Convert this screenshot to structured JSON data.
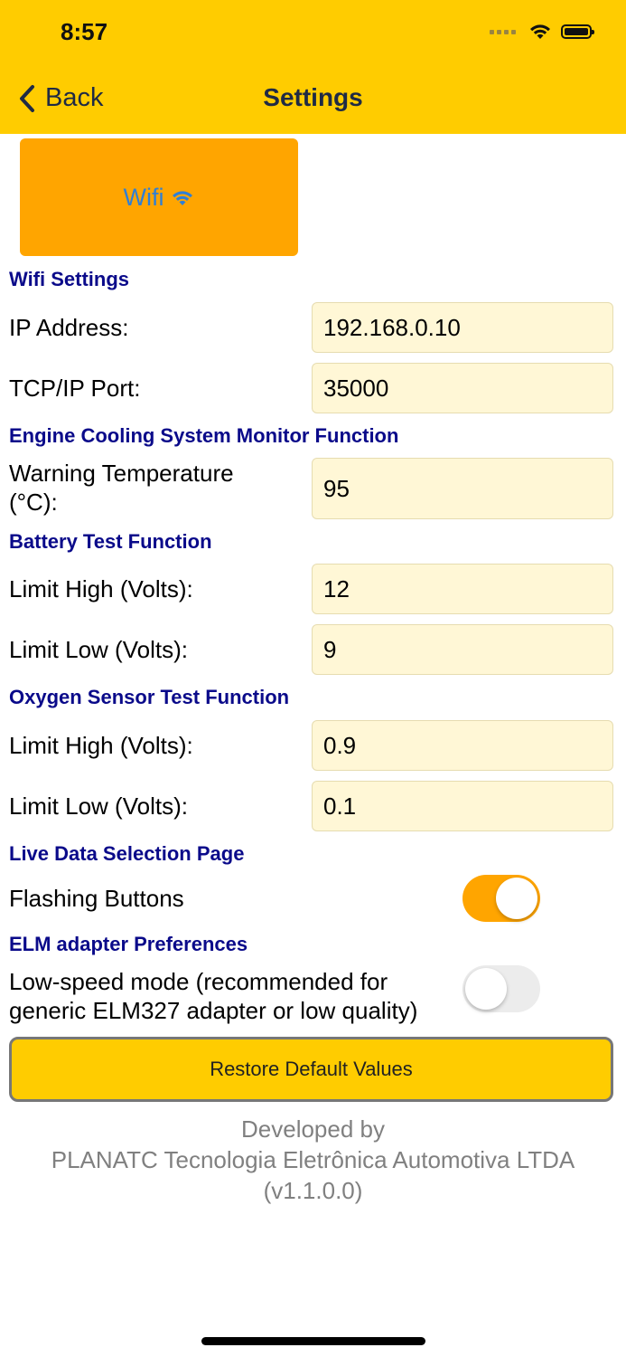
{
  "status_bar": {
    "time": "8:57"
  },
  "nav": {
    "back_label": "Back",
    "title": "Settings"
  },
  "wifi_tile": {
    "label": "Wifi",
    "icon": "wifi-icon",
    "color": "#FFA500"
  },
  "sections": {
    "wifi": "Wifi Settings",
    "cooling": "Engine Cooling System Monitor Function",
    "battery": "Battery Test Function",
    "oxygen": "Oxygen Sensor Test Function",
    "live_data": "Live Data Selection Page",
    "elm": "ELM adapter Preferences"
  },
  "fields": {
    "ip_address": {
      "label": "IP Address:",
      "value": "192.168.0.10"
    },
    "tcp_port": {
      "label": "TCP/IP Port:",
      "value": "35000"
    },
    "warning_temp": {
      "label_line1": "Warning Temperature",
      "label_line2": "(°C):",
      "value": "95"
    },
    "battery_high": {
      "label": "Limit High (Volts):",
      "value": "12"
    },
    "battery_low": {
      "label": "Limit Low (Volts):",
      "value": "9"
    },
    "oxygen_high": {
      "label": "Limit High (Volts):",
      "value": "0.9"
    },
    "oxygen_low": {
      "label": "Limit Low (Volts):",
      "value": "0.1"
    }
  },
  "toggles": {
    "flashing_buttons": {
      "label": "Flashing Buttons",
      "state": "on"
    },
    "low_speed": {
      "label_line1": "Low-speed mode (recommended for",
      "label_line2": "generic ELM327 adapter or low quality)",
      "state": "off"
    }
  },
  "restore_button": {
    "label": "Restore Default Values"
  },
  "footer": {
    "line1": "Developed by",
    "line2": "PLANATC Tecnologia Eletrônica Automotiva LTDA",
    "line3": "(v1.1.0.0)"
  },
  "colors": {
    "header": "#FFCC00",
    "accent": "#FFA500",
    "section_title": "#0a0a8a",
    "field_bg": "#FFF7D6"
  }
}
